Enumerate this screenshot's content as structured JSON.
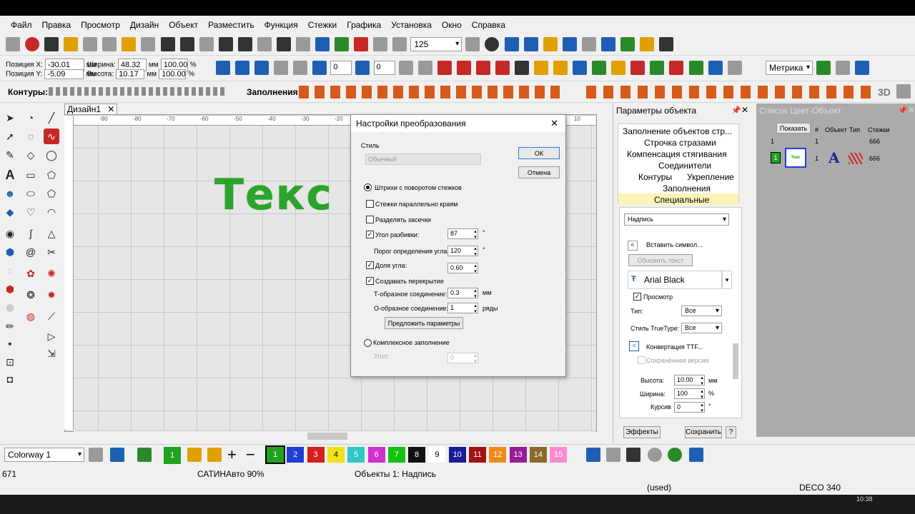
{
  "menu": [
    "Файл",
    "Правка",
    "Просмотр",
    "Дизайн",
    "Объект",
    "Разместить",
    "Функция",
    "Стежки",
    "Графика",
    "Установка",
    "Окно",
    "Справка"
  ],
  "toolbar": {
    "zoom": "125",
    "metric": "Метрика",
    "angle1": "0",
    "angle2": "0"
  },
  "position": {
    "x_label": "Позиция X:",
    "x_value": "-30.01",
    "y_label": "Позиция Y:",
    "y_value": "-5.09",
    "w_label": "Ширина:",
    "w_value": "48.32",
    "h_label": "Высота:",
    "h_value": "10.17",
    "unit": "мм",
    "pct1": "100.00",
    "pct2": "100.00",
    "pct_sign": "%"
  },
  "strip": {
    "contours": "Контуры:",
    "fills": "Заполнения:",
    "3d": "3D"
  },
  "design_tab": "Дизайн1",
  "canvas_text": "Текс",
  "ruler_top": [
    "-90",
    "-80",
    "-70",
    "-60",
    "-50",
    "-40",
    "-30",
    "-20",
    "-10",
    "0",
    "10"
  ],
  "ruler_left": [
    "10",
    "0",
    "-10",
    "-20",
    "-30",
    "-40",
    "-50",
    "-60",
    "-70"
  ],
  "dialog": {
    "title": "Настройки преобразования",
    "style_label": "Стиль",
    "style_value": "Обычный",
    "ok": "ОК",
    "cancel": "Отмена",
    "opt_rotate": "Штрихи с поворотом стежков",
    "opt_parallel": "Стежки параллельно краям",
    "opt_serif": "Разделять засечки",
    "opt_angle": "Угол разбивки:",
    "angle_value": "87",
    "threshold_label": "Порог определения угла:",
    "threshold_value": "120",
    "deg": "°",
    "ratio_label": "Доля угла:",
    "ratio_value": "0.60",
    "overlap_label": "Создавать перекрытие",
    "t_label": "Т-образное соединение:",
    "t_value": "0.3",
    "t_unit": "мм",
    "o_label": "О-образное соединение:",
    "o_value": "1",
    "o_unit": "ряды",
    "suggest": "Предложить параметры",
    "complex": "Комплексное заполнение",
    "angle2_label": "Угол:",
    "angle2_value": "0"
  },
  "objpanel": {
    "title": "Параметры объекта",
    "items": [
      "Заполнение объектов стр...",
      "Строчка стразами",
      "Компенсация стягивания",
      "Соединители",
      "Контуры",
      "Укрепление",
      "Заполнения",
      "Специальные"
    ],
    "type_select": "Надпись",
    "insert_symbol": "Вставить символ...",
    "update_text": "Обновить текст",
    "font": "Arial Black",
    "preview": "Просмотр",
    "type_label": "Тип:",
    "type_value": "Все",
    "ttf_label": "Стиль TrueType:",
    "ttf_value": "Все",
    "convert": "Конвертация TTF...",
    "saved": "Сохранённая версия",
    "height_label": "Высота:",
    "height_value": "10.00",
    "height_unit": "мм",
    "width_label": "Ширина:",
    "width_value": "100",
    "width_unit": "%",
    "italic_label": "Курсив",
    "italic_value": "0",
    "italic_unit": "°",
    "effects": "Эффекты",
    "save": "Сохранить",
    "help": "?"
  },
  "colorpanel": {
    "title": "Список Цвет-Объект",
    "show": "Показать",
    "headers": [
      "#",
      "Объект",
      "Тип",
      "Стежки"
    ],
    "row1": [
      "1",
      "",
      "",
      "666"
    ],
    "row2_num": "1",
    "row2_idx": "1",
    "row2_thumb": "Текс",
    "row2_type": "A",
    "row2_stitches": "666"
  },
  "bottombar": {
    "colorway": "Colorway 1",
    "swatches": [
      {
        "n": "1",
        "c": "#1fa31f"
      },
      {
        "n": "2",
        "c": "#1f3fd6"
      },
      {
        "n": "3",
        "c": "#d61f1f"
      },
      {
        "n": "4",
        "c": "#f2e21a"
      },
      {
        "n": "5",
        "c": "#2fc7c7"
      },
      {
        "n": "6",
        "c": "#d12fd1"
      },
      {
        "n": "7",
        "c": "#12c212"
      },
      {
        "n": "8",
        "c": "#111111"
      },
      {
        "n": "9",
        "c": "#ffffff"
      },
      {
        "n": "10",
        "c": "#1a1a9a"
      },
      {
        "n": "11",
        "c": "#a11212"
      },
      {
        "n": "12",
        "c": "#f28a1a"
      },
      {
        "n": "13",
        "c": "#9a1a9a"
      },
      {
        "n": "14",
        "c": "#8a6a2a"
      },
      {
        "n": "15",
        "c": "#ff8ad0"
      }
    ],
    "swatch_first": "1"
  },
  "status": {
    "count": "671",
    "satin": "САТИНАвто 90%",
    "objects": "Объекты 1: Надпись",
    "used": "(used)",
    "machine": "DECO 340",
    "clock": "10:38"
  }
}
